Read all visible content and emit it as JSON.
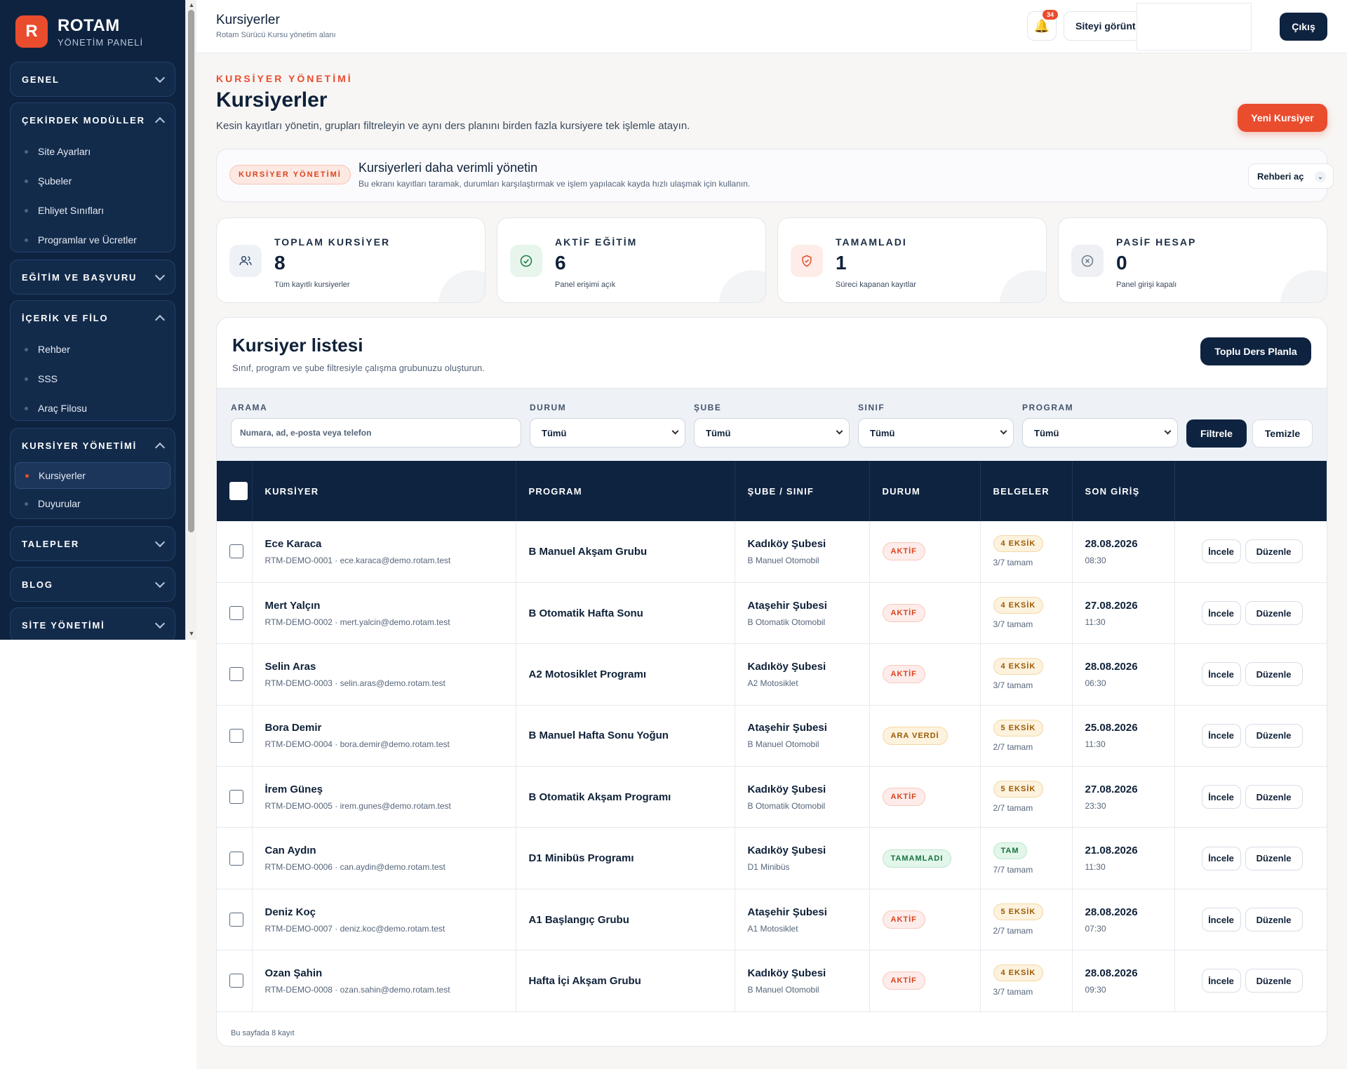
{
  "sidebar": {
    "brand_name": "ROTAM",
    "brand_sub": "YÖNETİM PANELİ",
    "brand_letter": "R",
    "groups": {
      "genel": "GENEL",
      "cekirdek": "ÇEKİRDEK MODÜLLER",
      "egitim": "EĞİTİM VE BAŞVURU",
      "icerik": "İÇERİK VE FİLO",
      "kursiyer": "KURSİYER YÖNETİMİ",
      "talepler": "TALEPLER",
      "blog": "BLOG",
      "site": "SİTE YÖNETİMİ"
    },
    "cekirdek_items": [
      "Site Ayarları",
      "Şubeler",
      "Ehliyet Sınıfları",
      "Programlar ve Ücretler"
    ],
    "icerik_items": [
      "Rehber",
      "SSS",
      "Araç Filosu"
    ],
    "kursiyer_items": [
      "Kursiyerler",
      "Duyurular"
    ]
  },
  "topbar": {
    "title": "Kursiyerler",
    "subtitle": "Rotam Sürücü Kursu yönetim alanı",
    "notification_count": "34",
    "site_button": "Siteyi görünt",
    "logout_button": "Çıkış"
  },
  "page": {
    "eyebrow": "KURSİYER YÖNETİMİ",
    "title": "Kursiyerler",
    "description": "Kesin kayıtları yönetin, grupları filtreleyin ve aynı ders planını birden fazla kursiyere tek işlemle atayın.",
    "new_button": "Yeni Kursiyer"
  },
  "hint": {
    "pill": "KURSİYER YÖNETİMİ",
    "title": "Kursiyerleri daha verimli yönetin",
    "subtitle": "Bu ekranı kayıtları taramak, durumları karşılaştırmak ve işlem yapılacak kayda hızlı ulaşmak için kullanın.",
    "guide_button": "Rehberi aç"
  },
  "stats": [
    {
      "label": "TOPLAM KURSİYER",
      "value": "8",
      "sub": "Tüm kayıtlı kursiyerler",
      "icon": "users-icon",
      "color": "#eef2f7"
    },
    {
      "label": "AKTİF EĞİTİM",
      "value": "6",
      "sub": "Panel erişimi açık",
      "icon": "check-circle-icon",
      "color": "#e7f5ec"
    },
    {
      "label": "TAMAMLADI",
      "value": "1",
      "sub": "Süreci kapanan kayıtlar",
      "icon": "shield-check-icon",
      "color": "#fdece7"
    },
    {
      "label": "PASİF HESAP",
      "value": "0",
      "sub": "Panel girişi kapalı",
      "icon": "x-circle-icon",
      "color": "#eef0f3"
    }
  ],
  "list": {
    "title": "Kursiyer listesi",
    "subtitle": "Sınıf, program ve şube filtresiyle çalışma grubunuzu oluşturun.",
    "bulk_button": "Toplu Ders Planla",
    "footer": "Bu sayfada 8 kayıt"
  },
  "filters": {
    "search_label": "ARAMA",
    "search_placeholder": "Numara, ad, e-posta veya telefon",
    "status_label": "DURUM",
    "status_value": "Tümü",
    "branch_label": "ŞUBE",
    "branch_value": "Tümü",
    "class_label": "SINIF",
    "class_value": "Tümü",
    "program_label": "PROGRAM",
    "program_value": "Tümü",
    "filter_button": "Filtrele",
    "clear_button": "Temizle"
  },
  "table": {
    "columns": [
      "KURSİYER",
      "PROGRAM",
      "ŞUBE / SINIF",
      "DURUM",
      "BELGELER",
      "SON GİRİŞ"
    ],
    "view_label": "İncele",
    "edit_label": "Düzenle",
    "rows": [
      {
        "name": "Ece Karaca",
        "meta": "RTM-DEMO-0001 · ece.karaca@demo.rotam.test",
        "program": "B Manuel Akşam Grubu",
        "branch": "Kadıköy Şubesi",
        "class": "B Manuel Otomobil",
        "status": "AKTİF",
        "status_kind": "aktif",
        "docs": "4 EKSİK",
        "docs_kind": "missing",
        "docs_sub": "3/7 tamam",
        "date": "28.08.2026",
        "time": "08:30"
      },
      {
        "name": "Mert Yalçın",
        "meta": "RTM-DEMO-0002 · mert.yalcin@demo.rotam.test",
        "program": "B Otomatik Hafta Sonu",
        "branch": "Ataşehir Şubesi",
        "class": "B Otomatik Otomobil",
        "status": "AKTİF",
        "status_kind": "aktif",
        "docs": "4 EKSİK",
        "docs_kind": "missing",
        "docs_sub": "3/7 tamam",
        "date": "27.08.2026",
        "time": "11:30"
      },
      {
        "name": "Selin Aras",
        "meta": "RTM-DEMO-0003 · selin.aras@demo.rotam.test",
        "program": "A2 Motosiklet Programı",
        "branch": "Kadıköy Şubesi",
        "class": "A2 Motosiklet",
        "status": "AKTİF",
        "status_kind": "aktif",
        "docs": "4 EKSİK",
        "docs_kind": "missing",
        "docs_sub": "3/7 tamam",
        "date": "28.08.2026",
        "time": "06:30"
      },
      {
        "name": "Bora Demir",
        "meta": "RTM-DEMO-0004 · bora.demir@demo.rotam.test",
        "program": "B Manuel Hafta Sonu Yoğun",
        "branch": "Ataşehir Şubesi",
        "class": "B Manuel Otomobil",
        "status": "ARA VERDİ",
        "status_kind": "ara",
        "docs": "5 EKSİK",
        "docs_kind": "missing",
        "docs_sub": "2/7 tamam",
        "date": "25.08.2026",
        "time": "11:30"
      },
      {
        "name": "İrem Güneş",
        "meta": "RTM-DEMO-0005 · irem.gunes@demo.rotam.test",
        "program": "B Otomatik Akşam Programı",
        "branch": "Kadıköy Şubesi",
        "class": "B Otomatik Otomobil",
        "status": "AKTİF",
        "status_kind": "aktif",
        "docs": "5 EKSİK",
        "docs_kind": "missing",
        "docs_sub": "2/7 tamam",
        "date": "27.08.2026",
        "time": "23:30"
      },
      {
        "name": "Can Aydın",
        "meta": "RTM-DEMO-0006 · can.aydin@demo.rotam.test",
        "program": "D1 Minibüs Programı",
        "branch": "Kadıköy Şubesi",
        "class": "D1 Minibüs",
        "status": "TAMAMLADI",
        "status_kind": "tam",
        "docs": "TAM",
        "docs_kind": "full",
        "docs_sub": "7/7 tamam",
        "date": "21.08.2026",
        "time": "11:30"
      },
      {
        "name": "Deniz Koç",
        "meta": "RTM-DEMO-0007 · deniz.koc@demo.rotam.test",
        "program": "A1 Başlangıç Grubu",
        "branch": "Ataşehir Şubesi",
        "class": "A1 Motosiklet",
        "status": "AKTİF",
        "status_kind": "aktif",
        "docs": "5 EKSİK",
        "docs_kind": "missing",
        "docs_sub": "2/7 tamam",
        "date": "28.08.2026",
        "time": "07:30"
      },
      {
        "name": "Ozan Şahin",
        "meta": "RTM-DEMO-0008 · ozan.sahin@demo.rotam.test",
        "program": "Hafta İçi Akşam Grubu",
        "branch": "Kadıköy Şubesi",
        "class": "B Manuel Otomobil",
        "status": "AKTİF",
        "status_kind": "aktif",
        "docs": "4 EKSİK",
        "docs_kind": "missing",
        "docs_sub": "3/7 tamam",
        "date": "28.08.2026",
        "time": "09:30"
      }
    ]
  }
}
